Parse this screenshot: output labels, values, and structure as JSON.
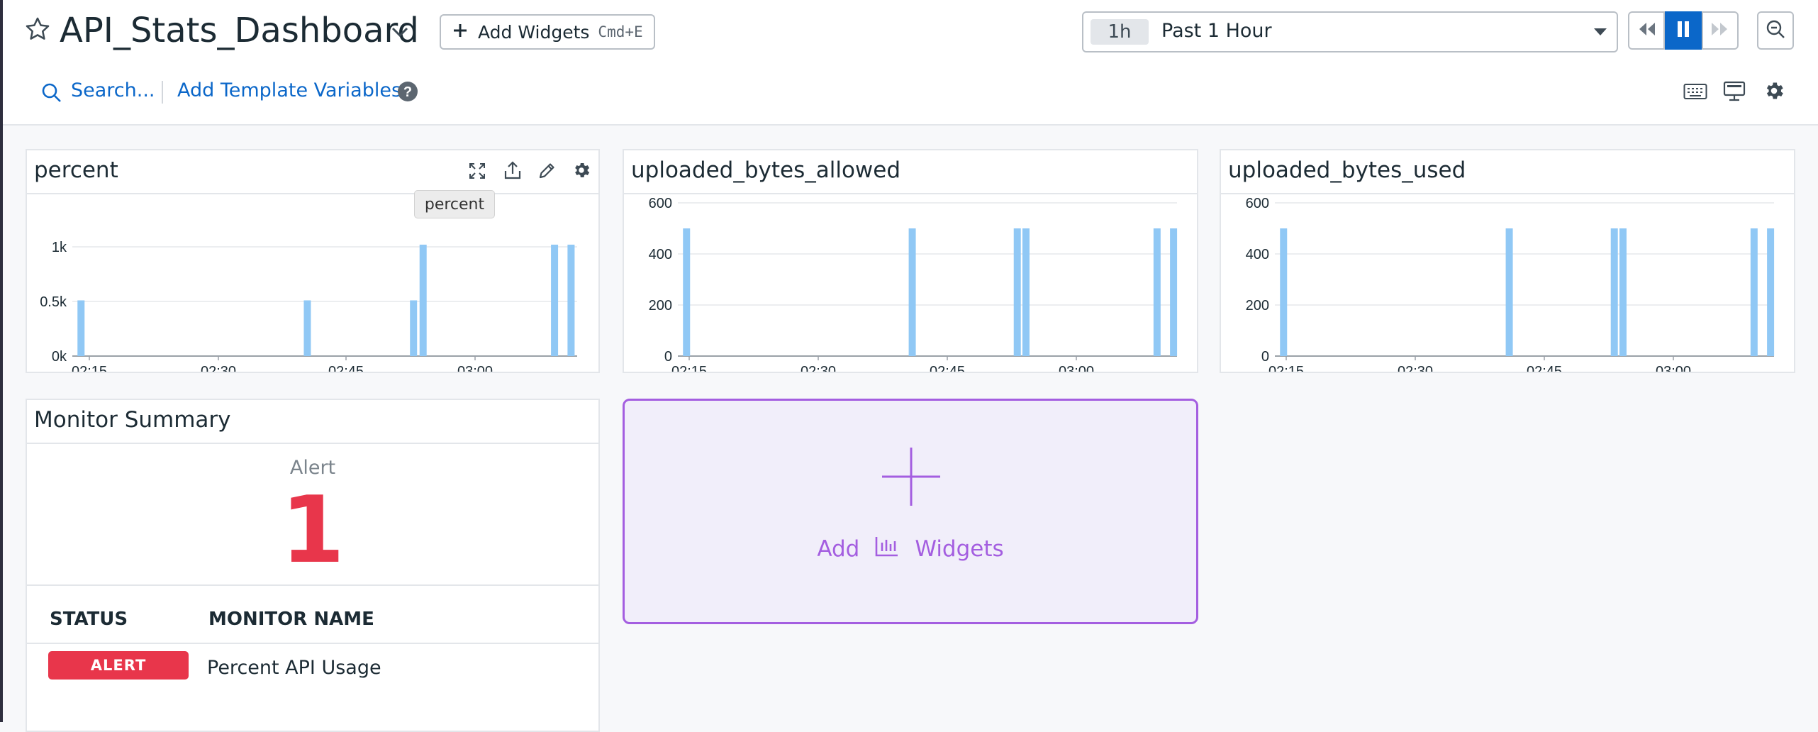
{
  "header": {
    "dashboard_title": "API_Stats_Dashboard",
    "add_widgets_label": "Add Widgets",
    "add_widgets_shortcut": "Cmd+E",
    "search_label": "Search...",
    "template_vars_label": "Add Template Variables"
  },
  "timeframe": {
    "badge": "1h",
    "label": "Past 1 Hour"
  },
  "icons": [
    "star-icon",
    "chevron-down-icon",
    "plus-icon",
    "search-icon",
    "help-icon",
    "rewind-icon",
    "pause-icon",
    "fast-forward-icon",
    "zoom-out-icon",
    "keyboard-icon",
    "monitor-icon",
    "gear-icon",
    "expand-icon",
    "export-icon",
    "edit-icon",
    "bar-chart-icon"
  ],
  "colors": {
    "bar": "#90c8f5",
    "accent_blue": "#0b67c9",
    "alert_red": "#e8364b",
    "purple": "#a45ee0",
    "purple_bg": "#f1eefa"
  },
  "widgets": {
    "percent": {
      "title": "percent",
      "tooltip": "percent"
    },
    "allowed": {
      "title": "uploaded_bytes_allowed"
    },
    "used": {
      "title": "uploaded_bytes_used"
    }
  },
  "monitor_summary": {
    "title": "Monitor Summary",
    "status_heading": "Alert",
    "count": "1",
    "col_status": "STATUS",
    "col_name": "MONITOR NAME",
    "rows": [
      {
        "status": "ALERT",
        "name": "Percent API Usage"
      }
    ]
  },
  "add_widget_tile": {
    "add": "Add",
    "widgets": "Widgets"
  },
  "chart_data": [
    {
      "type": "bar",
      "title": "percent",
      "x_ticks": [
        "02:15",
        "02:30",
        "02:45",
        "03:00"
      ],
      "y_ticks": [
        "0k",
        "0.5k",
        "1k"
      ],
      "ylim": [
        0,
        1000
      ],
      "xlim_minutes": [
        11.5,
        69.5
      ],
      "bars": [
        {
          "t": 12.5,
          "value": 510
        },
        {
          "t": 38.5,
          "value": 510
        },
        {
          "t": 50.7,
          "value": 510
        },
        {
          "t": 51.8,
          "value": 1020
        },
        {
          "t": 66.9,
          "value": 1020
        },
        {
          "t": 68.8,
          "value": 1020
        }
      ],
      "grid": true
    },
    {
      "type": "bar",
      "title": "uploaded_bytes_allowed",
      "x_ticks": [
        "02:15",
        "02:30",
        "02:45",
        "03:00"
      ],
      "y_ticks": [
        "0",
        "200",
        "400",
        "600"
      ],
      "ylim": [
        0,
        600
      ],
      "xlim_minutes": [
        13.0,
        70.5
      ],
      "bars": [
        {
          "t": 14.0,
          "value": 500
        },
        {
          "t": 40.0,
          "value": 500
        },
        {
          "t": 52.1,
          "value": 500
        },
        {
          "t": 53.1,
          "value": 500
        },
        {
          "t": 68.2,
          "value": 500
        },
        {
          "t": 70.1,
          "value": 500
        }
      ],
      "grid": true
    },
    {
      "type": "bar",
      "title": "uploaded_bytes_used",
      "x_ticks": [
        "02:15",
        "02:30",
        "02:45",
        "03:00"
      ],
      "y_ticks": [
        "0",
        "200",
        "400",
        "600"
      ],
      "ylim": [
        0,
        600
      ],
      "xlim_minutes": [
        13.0,
        70.5
      ],
      "bars": [
        {
          "t": 14.0,
          "value": 500
        },
        {
          "t": 40.0,
          "value": 500
        },
        {
          "t": 52.1,
          "value": 500
        },
        {
          "t": 53.1,
          "value": 500
        },
        {
          "t": 68.2,
          "value": 500
        },
        {
          "t": 70.1,
          "value": 500
        }
      ],
      "grid": true
    }
  ]
}
